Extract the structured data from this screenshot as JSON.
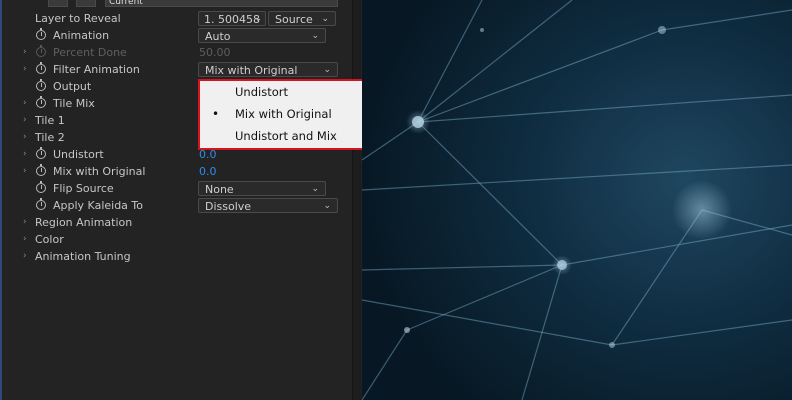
{
  "topbar": {
    "field_value": "Current"
  },
  "rows": {
    "layer_to_reveal": {
      "label": "Layer to Reveal",
      "value": "1. 500458",
      "source": "Source"
    },
    "animation": {
      "label": "Animation",
      "value": "Auto"
    },
    "percent_done": {
      "label": "Percent Done",
      "value": "50.00"
    },
    "filter_animation": {
      "label": "Filter Animation",
      "value": "Mix with Original"
    },
    "output": {
      "label": "Output"
    },
    "tile_mix": {
      "label": "Tile Mix"
    },
    "tile1": {
      "label": "Tile 1"
    },
    "tile2": {
      "label": "Tile 2"
    },
    "undistort": {
      "label": "Undistort",
      "value": "0.0"
    },
    "mix_with_original": {
      "label": "Mix with Original",
      "value": "0.0"
    },
    "flip_source": {
      "label": "Flip Source",
      "value": "None"
    },
    "apply_kaleida_to": {
      "label": "Apply Kaleida To",
      "value": "Dissolve"
    },
    "region_animation": {
      "label": "Region Animation"
    },
    "color": {
      "label": "Color"
    },
    "animation_tuning": {
      "label": "Animation Tuning"
    }
  },
  "menu": {
    "selected": "Mix with Original",
    "items": [
      "Undistort",
      "Mix with Original",
      "Undistort and Mix"
    ],
    "border_color": "#d8121f"
  },
  "colors": {
    "panel_bg": "#232323",
    "value_blue": "#2d8ceb",
    "viewer_bg": "#0c2535"
  }
}
